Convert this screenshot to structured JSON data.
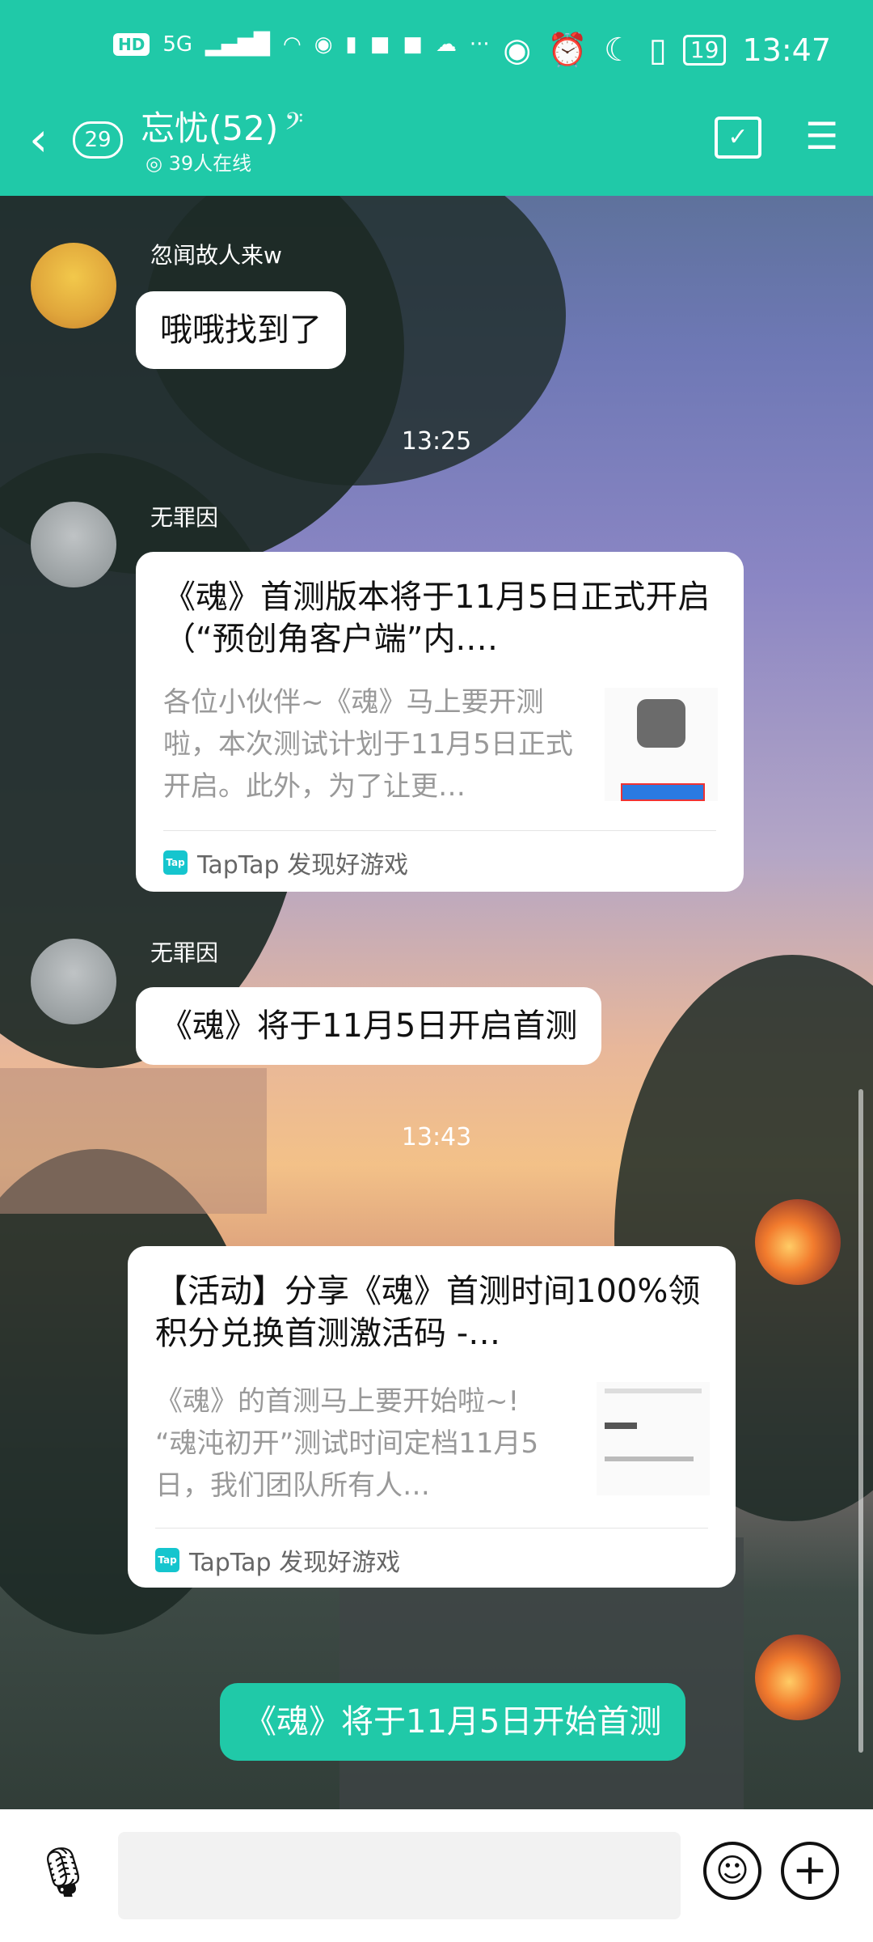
{
  "status_bar": {
    "hd": "HD",
    "network": "5G",
    "time": "13:47",
    "battery": "19",
    "more": "···"
  },
  "header": {
    "back_icon": "‹",
    "unread_count": "29",
    "title": "忘忧(52)",
    "online": "39人在线"
  },
  "messages": [
    {
      "sender": "忽闻故人来w",
      "text": "哦哦找到了"
    },
    {
      "time": "13:25"
    },
    {
      "sender": "无罪因",
      "card": {
        "title": "《魂》首测版本将于11月5日正式开启（“预创角客户端”内.…",
        "desc": "各位小伙伴~《魂》马上要开测啦，本次测试计划于11月5日正式开启。此外，为了让更…",
        "source": "TapTap 发现好游戏"
      }
    },
    {
      "sender": "无罪因",
      "text": "《魂》将于11月5日开启首测"
    },
    {
      "time": "13:43"
    },
    {
      "card": {
        "title": "【活动】分享《魂》首测时间100%领积分兑换首测激活码 -…",
        "desc": "《魂》的首测马上要开始啦~!\n“魂沌初开”测试时间定档11月5日，我们团队所有人…",
        "source": "TapTap 发现好游戏"
      }
    },
    {
      "text": "《魂》将于11月5日开始首测"
    }
  ],
  "tap_logo": "Tap",
  "input": {
    "placeholder": ""
  },
  "colors": {
    "accent": "#20c9a8"
  }
}
